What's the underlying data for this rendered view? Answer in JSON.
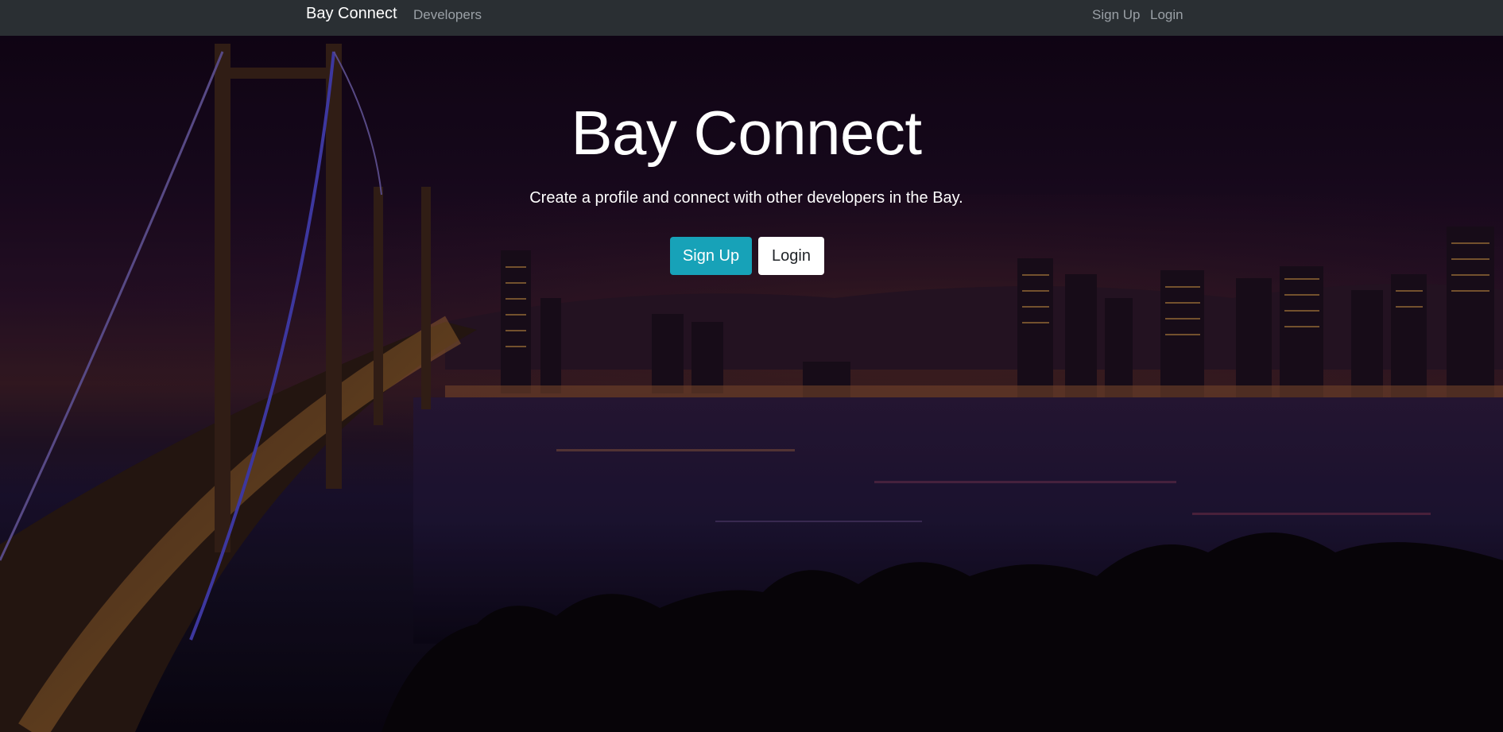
{
  "navbar": {
    "brand": "Bay Connect",
    "links": {
      "developers": "Developers",
      "signup": "Sign Up",
      "login": "Login"
    }
  },
  "hero": {
    "title": "Bay Connect",
    "lead": "Create a profile and connect with other developers in the Bay.",
    "buttons": {
      "signup": "Sign Up",
      "login": "Login"
    }
  },
  "colors": {
    "navbar_bg": "#2a2f33",
    "primary_button": "#17a2b8",
    "secondary_button": "#ffffff"
  }
}
